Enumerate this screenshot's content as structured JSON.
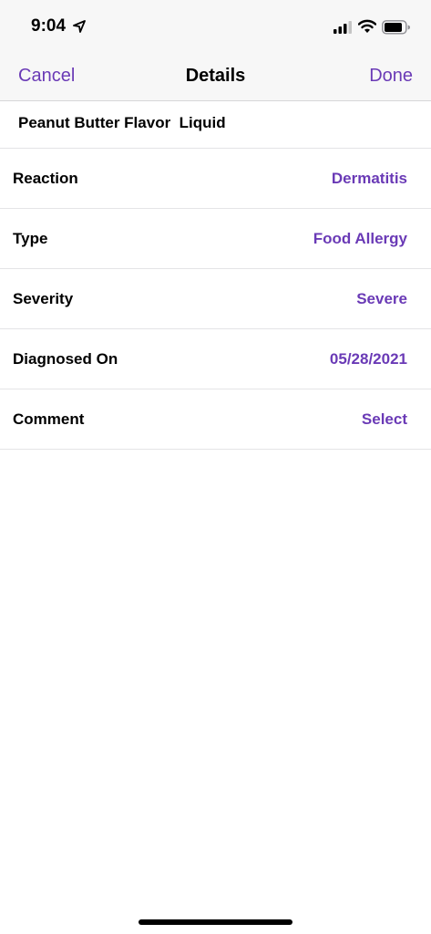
{
  "status_bar": {
    "time": "9:04",
    "icons": [
      "location-arrow-icon",
      "cellular-signal-icon",
      "wifi-icon",
      "battery-icon"
    ]
  },
  "nav": {
    "cancel_label": "Cancel",
    "title": "Details",
    "done_label": "Done"
  },
  "item": {
    "name": "Peanut Butter Flavor  Liquid"
  },
  "details": [
    {
      "label": "Reaction",
      "value": "Dermatitis"
    },
    {
      "label": "Type",
      "value": "Food Allergy"
    },
    {
      "label": "Severity",
      "value": "Severe"
    },
    {
      "label": "Diagnosed On",
      "value": "05/28/2021"
    },
    {
      "label": "Comment",
      "value": "Select"
    }
  ],
  "colors": {
    "accent": "#6a3ab6",
    "bar_background": "#f7f7f7",
    "separator": "#e4e4e6"
  }
}
